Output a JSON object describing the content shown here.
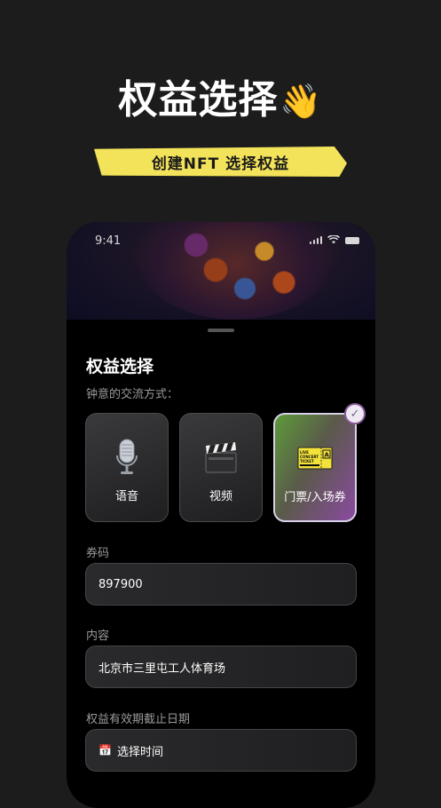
{
  "hero": {
    "title": "权益选择",
    "emoji": "👋"
  },
  "ribbon": {
    "text": "创建NFT 选择权益"
  },
  "status_bar": {
    "time": "9:41"
  },
  "sheet": {
    "title": "权益选择",
    "subtitle": "钟意的交流方式：",
    "options": [
      {
        "label": "语音",
        "icon": "microphone-icon",
        "selected": false
      },
      {
        "label": "视频",
        "icon": "clapperboard-icon",
        "selected": false
      },
      {
        "label": "门票/入场券",
        "icon": "concert-ticket-icon",
        "selected": true
      }
    ],
    "ticket_icon_text": {
      "line1": "LIVE",
      "line2": "CONCERT",
      "line3": "TICKET"
    },
    "code": {
      "label": "券码",
      "value": "897900"
    },
    "content": {
      "label": "内容",
      "value": "北京市三里屯工人体育场"
    },
    "expiry": {
      "label": "权益有效期截止日期",
      "placeholder": "选择时间"
    }
  },
  "colors": {
    "background": "#1c1c1d",
    "ribbon": "#f3e35a",
    "selected_gradient_start": "#5d9a3a",
    "selected_gradient_end": "#8a4aa0"
  }
}
